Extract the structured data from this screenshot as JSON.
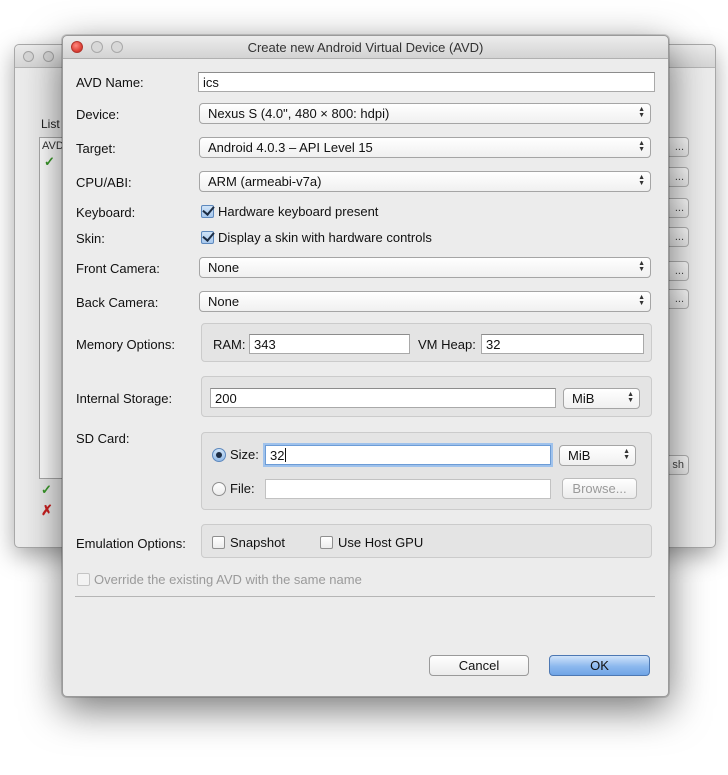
{
  "background_window": {
    "list_label": "List",
    "list_header": "AVD",
    "side_buttons": [
      "...",
      "...",
      "...",
      "...",
      "...",
      "...",
      "sh"
    ]
  },
  "dialog": {
    "title": "Create new Android Virtual Device (AVD)",
    "avd_name": {
      "label": "AVD Name:",
      "value": "ics"
    },
    "device": {
      "label": "Device:",
      "value": "Nexus S (4.0\", 480 × 800: hdpi)"
    },
    "target": {
      "label": "Target:",
      "value": "Android 4.0.3 – API Level 15"
    },
    "cpu_abi": {
      "label": "CPU/ABI:",
      "value": "ARM (armeabi-v7a)"
    },
    "keyboard": {
      "label": "Keyboard:",
      "checkbox_label": "Hardware keyboard present",
      "checked": true
    },
    "skin": {
      "label": "Skin:",
      "checkbox_label": "Display a skin with hardware controls",
      "checked": true
    },
    "front_camera": {
      "label": "Front Camera:",
      "value": "None"
    },
    "back_camera": {
      "label": "Back Camera:",
      "value": "None"
    },
    "memory": {
      "label": "Memory Options:",
      "ram_label": "RAM:",
      "ram_value": "343",
      "vm_heap_label": "VM Heap:",
      "vm_heap_value": "32"
    },
    "internal_storage": {
      "label": "Internal Storage:",
      "value": "200",
      "unit": "MiB"
    },
    "sd_card": {
      "label": "SD Card:",
      "size_label": "Size:",
      "size_value": "32",
      "size_unit": "MiB",
      "file_label": "File:",
      "file_value": "",
      "browse_label": "Browse..."
    },
    "emulation": {
      "label": "Emulation Options:",
      "snapshot_label": "Snapshot",
      "host_gpu_label": "Use Host GPU"
    },
    "override_label": "Override the existing AVD with the same name",
    "cancel_label": "Cancel",
    "ok_label": "OK"
  }
}
